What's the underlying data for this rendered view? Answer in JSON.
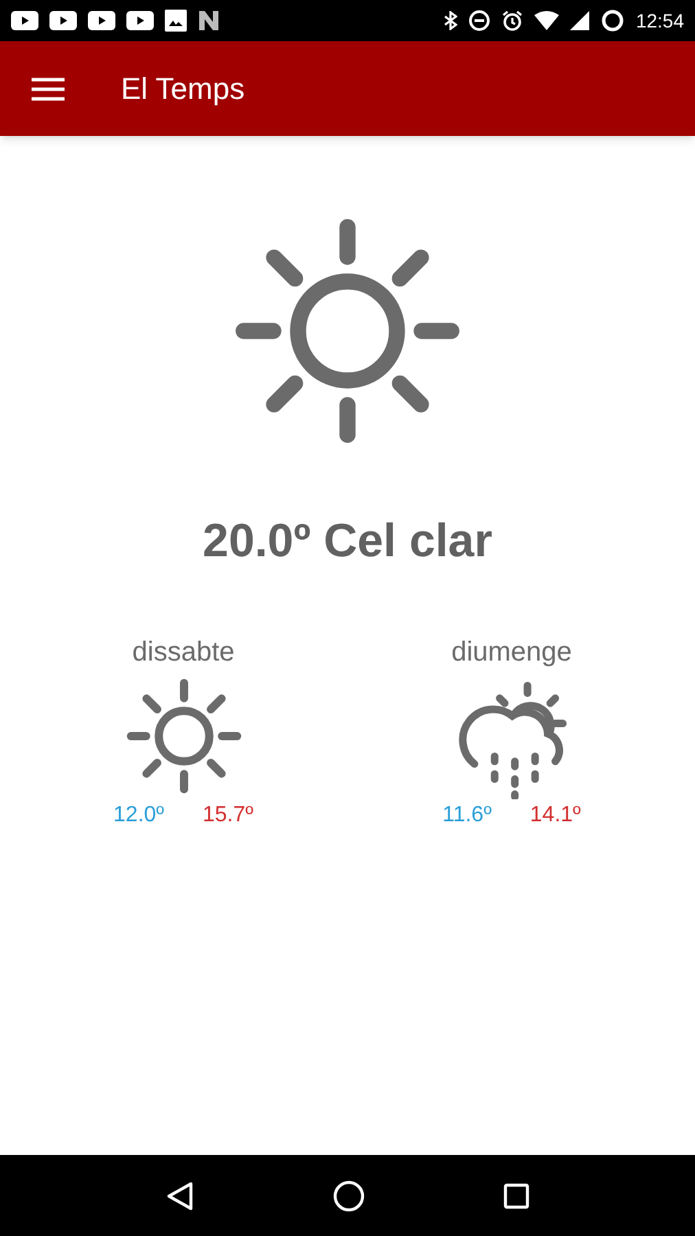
{
  "status_bar": {
    "time": "12:54"
  },
  "app_bar": {
    "title": "El Temps"
  },
  "current": {
    "kind": "sun",
    "reading": "20.0º Cel clar"
  },
  "forecast": [
    {
      "day": "dissabte",
      "kind": "sun",
      "min": "12.0º",
      "max": "15.7º"
    },
    {
      "day": "diumenge",
      "kind": "cloud-rain-sun",
      "min": "11.6º",
      "max": "14.1º"
    }
  ]
}
